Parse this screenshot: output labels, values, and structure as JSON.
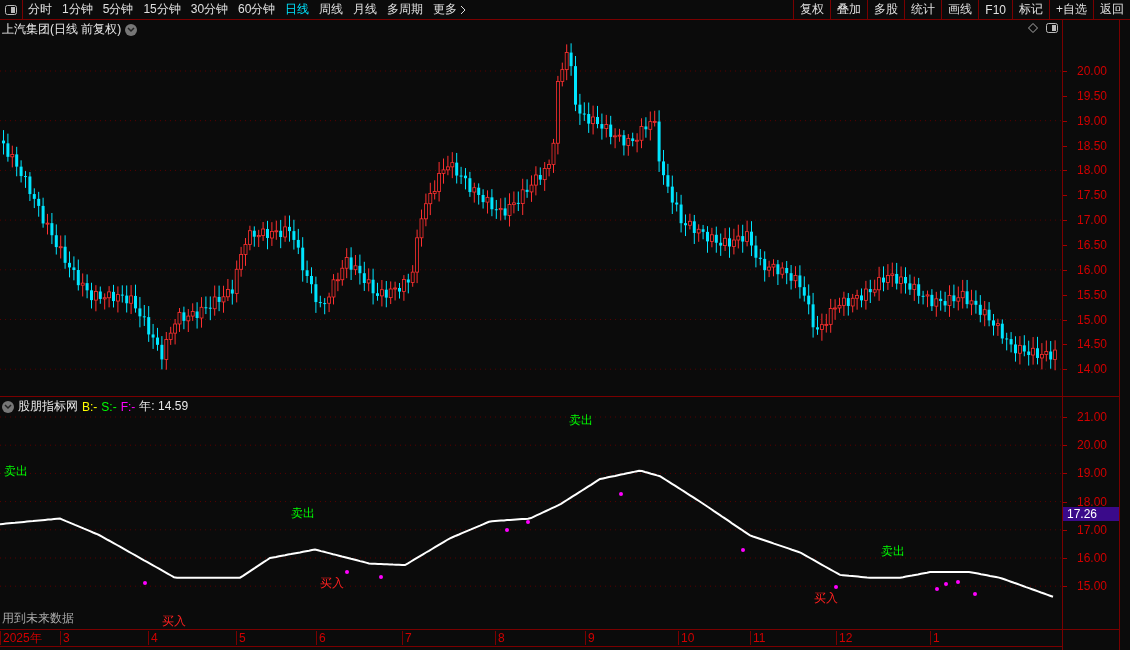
{
  "toolbar": {
    "periods": [
      {
        "label": "分时",
        "selected": false
      },
      {
        "label": "1分钟",
        "selected": false
      },
      {
        "label": "5分钟",
        "selected": false
      },
      {
        "label": "15分钟",
        "selected": false
      },
      {
        "label": "30分钟",
        "selected": false
      },
      {
        "label": "60分钟",
        "selected": false
      },
      {
        "label": "日线",
        "selected": true
      },
      {
        "label": "周线",
        "selected": false
      },
      {
        "label": "月线",
        "selected": false
      },
      {
        "label": "多周期",
        "selected": false
      },
      {
        "label": "更多",
        "selected": false
      }
    ],
    "buttons": [
      "复权",
      "叠加",
      "多股",
      "统计",
      "画线",
      "F10",
      "标记",
      "+自选",
      "返回"
    ]
  },
  "price_chart": {
    "title": "上汽集团(日线 前复权)",
    "axis_labels": [
      "20.00",
      "19.50",
      "19.00",
      "18.50",
      "18.00",
      "17.50",
      "17.00",
      "16.50",
      "16.00",
      "15.50",
      "15.00",
      "14.50",
      "14.00"
    ]
  },
  "indicator": {
    "name": "股朋指标网",
    "legend": [
      {
        "label": "B:-",
        "color": "#ffff00"
      },
      {
        "label": "S:-",
        "color": "#00ff00"
      },
      {
        "label": "F:-",
        "color": "#ff00ff"
      }
    ],
    "reading": "年: 14.59",
    "signals": [
      {
        "label": "卖出",
        "kind": "sell"
      },
      {
        "label": "卖出",
        "kind": "sell"
      },
      {
        "label": "卖出",
        "kind": "sell"
      },
      {
        "label": "卖出",
        "kind": "sell"
      },
      {
        "label": "买入",
        "kind": "buy"
      },
      {
        "label": "买入",
        "kind": "buy"
      },
      {
        "label": "买入",
        "kind": "buy"
      }
    ],
    "note": "用到未来数据",
    "axis_labels": [
      "21.00",
      "20.00",
      "19.00",
      "18.00",
      "17.00",
      "16.00",
      "15.00"
    ],
    "current_value": "17.26"
  },
  "date_axis": [
    "2025年",
    "3",
    "4",
    "5",
    "6",
    "7",
    "8",
    "9",
    "10",
    "11",
    "12",
    "1"
  ]
}
